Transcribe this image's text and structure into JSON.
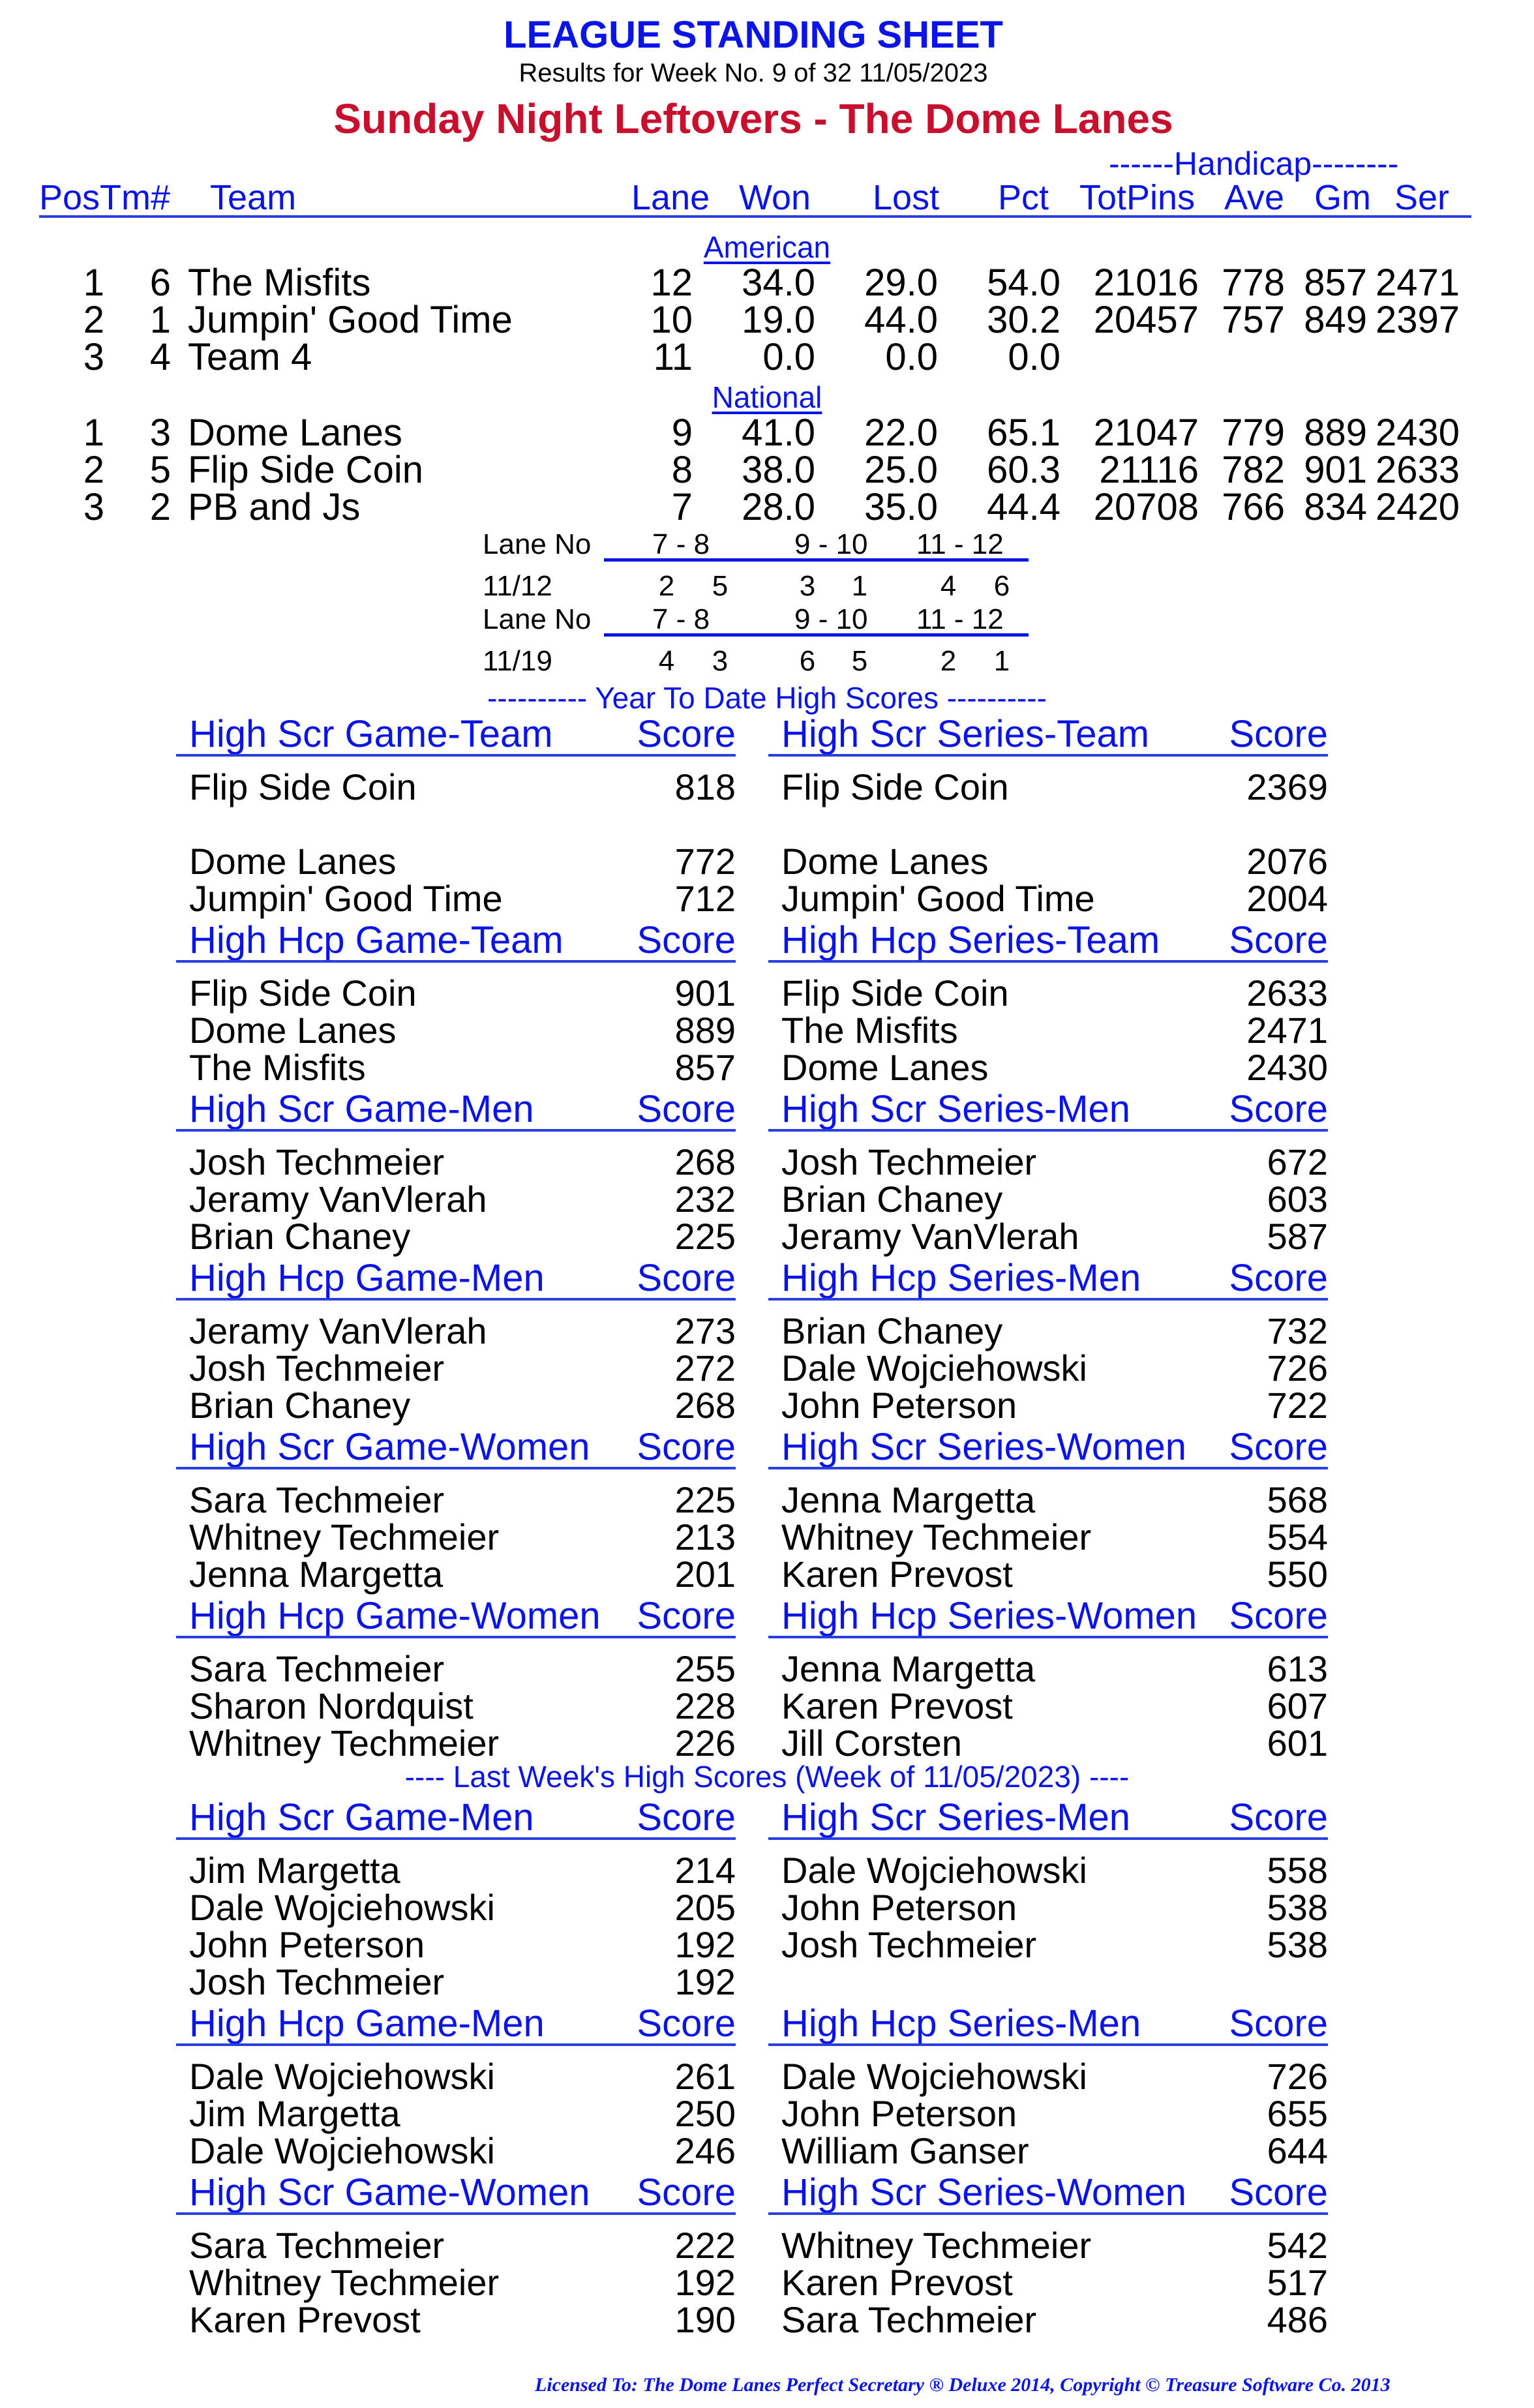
{
  "header": {
    "title": "LEAGUE STANDING SHEET",
    "subtitle": "Results for Week No. 9 of 32    11/05/2023",
    "league_name": "Sunday Night Leftovers - The Dome Lanes",
    "handicap_label": "------Handicap--------"
  },
  "columns": {
    "pos_tm": "PosTm#",
    "team": "Team",
    "lane": "Lane",
    "won": "Won",
    "lost": "Lost",
    "pct": "Pct",
    "totpins": "TotPins",
    "ave": "Ave",
    "gm": "Gm",
    "ser": "Ser"
  },
  "divisions": [
    {
      "name": "American",
      "teams": [
        {
          "pos": "1",
          "tm": "6",
          "team": "The Misfits",
          "lane": "12",
          "won": "34.0",
          "lost": "29.0",
          "pct": "54.0",
          "totpins": "21016",
          "ave": "778",
          "gm": "857",
          "ser": "2471"
        },
        {
          "pos": "2",
          "tm": "1",
          "team": "Jumpin' Good Time",
          "lane": "10",
          "won": "19.0",
          "lost": "44.0",
          "pct": "30.2",
          "totpins": "20457",
          "ave": "757",
          "gm": "849",
          "ser": "2397"
        },
        {
          "pos": "3",
          "tm": "4",
          "team": "Team 4",
          "lane": "11",
          "won": "0.0",
          "lost": "0.0",
          "pct": "0.0",
          "totpins": "",
          "ave": "",
          "gm": "",
          "ser": ""
        }
      ]
    },
    {
      "name": "National",
      "teams": [
        {
          "pos": "1",
          "tm": "3",
          "team": "Dome Lanes",
          "lane": "9",
          "won": "41.0",
          "lost": "22.0",
          "pct": "65.1",
          "totpins": "21047",
          "ave": "779",
          "gm": "889",
          "ser": "2430"
        },
        {
          "pos": "2",
          "tm": "5",
          "team": "Flip Side Coin",
          "lane": "8",
          "won": "38.0",
          "lost": "25.0",
          "pct": "60.3",
          "totpins": "21116",
          "ave": "782",
          "gm": "901",
          "ser": "2633"
        },
        {
          "pos": "3",
          "tm": "2",
          "team": "PB and Js",
          "lane": "7",
          "won": "28.0",
          "lost": "35.0",
          "pct": "44.4",
          "totpins": "20708",
          "ave": "766",
          "gm": "834",
          "ser": "2420"
        }
      ]
    }
  ],
  "lane_schedule": {
    "label": "Lane No",
    "pairs": [
      "7 -  8",
      "9 - 10",
      "11 - 12"
    ],
    "weeks": [
      {
        "date": "11/12",
        "teams": [
          "2",
          "5",
          "3",
          "1",
          "4",
          "6"
        ]
      },
      {
        "date": "11/19",
        "teams": [
          "4",
          "3",
          "6",
          "5",
          "2",
          "1"
        ]
      }
    ]
  },
  "ytd_banner": "---------- Year To Date High Scores ----------",
  "last_week_banner": "----  Last Week's High Scores   (Week of 11/05/2023)  ----",
  "score_label": "Score",
  "ytd_sections": [
    [
      {
        "title": "High Scr Game-Team",
        "rows": [
          [
            "Flip Side Coin",
            "818"
          ],
          [
            "",
            ""
          ],
          [
            "Dome Lanes",
            "772"
          ],
          [
            "Jumpin' Good Time",
            "712"
          ]
        ]
      },
      {
        "title": "High Scr Series-Team",
        "rows": [
          [
            "Flip Side Coin",
            "2369"
          ],
          [
            "",
            ""
          ],
          [
            "Dome Lanes",
            "2076"
          ],
          [
            "Jumpin' Good Time",
            "2004"
          ]
        ]
      }
    ],
    [
      {
        "title": "High Hcp Game-Team",
        "rows": [
          [
            "Flip Side Coin",
            "901"
          ],
          [
            "Dome Lanes",
            "889"
          ],
          [
            "The Misfits",
            "857"
          ]
        ]
      },
      {
        "title": "High Hcp Series-Team",
        "rows": [
          [
            "Flip Side Coin",
            "2633"
          ],
          [
            "The Misfits",
            "2471"
          ],
          [
            "Dome Lanes",
            "2430"
          ]
        ]
      }
    ],
    [
      {
        "title": "High Scr Game-Men",
        "rows": [
          [
            "Josh Techmeier",
            "268"
          ],
          [
            "Jeramy VanVlerah",
            "232"
          ],
          [
            "Brian Chaney",
            "225"
          ]
        ]
      },
      {
        "title": "High Scr Series-Men",
        "rows": [
          [
            "Josh Techmeier",
            "672"
          ],
          [
            "Brian Chaney",
            "603"
          ],
          [
            "Jeramy VanVlerah",
            "587"
          ]
        ]
      }
    ],
    [
      {
        "title": "High Hcp Game-Men",
        "rows": [
          [
            "Jeramy VanVlerah",
            "273"
          ],
          [
            "Josh Techmeier",
            "272"
          ],
          [
            "Brian Chaney",
            "268"
          ]
        ]
      },
      {
        "title": "High Hcp Series-Men",
        "rows": [
          [
            "Brian Chaney",
            "732"
          ],
          [
            "Dale Wojciehowski",
            "726"
          ],
          [
            "John Peterson",
            "722"
          ]
        ]
      }
    ],
    [
      {
        "title": "High Scr Game-Women",
        "rows": [
          [
            "Sara Techmeier",
            "225"
          ],
          [
            "Whitney Techmeier",
            "213"
          ],
          [
            "Jenna Margetta",
            "201"
          ]
        ]
      },
      {
        "title": "High Scr Series-Women",
        "rows": [
          [
            "Jenna Margetta",
            "568"
          ],
          [
            "Whitney Techmeier",
            "554"
          ],
          [
            "Karen Prevost",
            "550"
          ]
        ]
      }
    ],
    [
      {
        "title": "High Hcp Game-Women",
        "rows": [
          [
            "Sara Techmeier",
            "255"
          ],
          [
            "Sharon Nordquist",
            "228"
          ],
          [
            "Whitney Techmeier",
            "226"
          ]
        ]
      },
      {
        "title": "High Hcp Series-Women",
        "rows": [
          [
            "Jenna Margetta",
            "613"
          ],
          [
            "Karen Prevost",
            "607"
          ],
          [
            "Jill Corsten",
            "601"
          ]
        ]
      }
    ]
  ],
  "last_week_sections": [
    [
      {
        "title": "High Scr Game-Men",
        "rows": [
          [
            "Jim Margetta",
            "214"
          ],
          [
            "Dale Wojciehowski",
            "205"
          ],
          [
            "John Peterson",
            "192"
          ],
          [
            "Josh Techmeier",
            "192"
          ]
        ]
      },
      {
        "title": "High Scr Series-Men",
        "rows": [
          [
            "Dale Wojciehowski",
            "558"
          ],
          [
            "John Peterson",
            "538"
          ],
          [
            "Josh Techmeier",
            "538"
          ],
          [
            "",
            ""
          ]
        ]
      }
    ],
    [
      {
        "title": "High Hcp Game-Men",
        "rows": [
          [
            "Dale Wojciehowski",
            "261"
          ],
          [
            "Jim Margetta",
            "250"
          ],
          [
            "Dale Wojciehowski",
            "246"
          ]
        ]
      },
      {
        "title": "High Hcp Series-Men",
        "rows": [
          [
            "Dale Wojciehowski",
            "726"
          ],
          [
            "John Peterson",
            "655"
          ],
          [
            "William Ganser",
            "644"
          ]
        ]
      }
    ],
    [
      {
        "title": "High Scr Game-Women",
        "rows": [
          [
            "Sara Techmeier",
            "222"
          ],
          [
            "Whitney Techmeier",
            "192"
          ],
          [
            "Karen Prevost",
            "190"
          ]
        ]
      },
      {
        "title": "High Scr Series-Women",
        "rows": [
          [
            "Whitney Techmeier",
            "542"
          ],
          [
            "Karen Prevost",
            "517"
          ],
          [
            "Sara Techmeier",
            "486"
          ]
        ]
      }
    ]
  ],
  "footer": "Licensed To: The Dome Lanes     Perfect Secretary ® Deluxe  2014, Copyright © Treasure Software Co. 2013",
  "colors": {
    "heading_blue": "#0a14e6",
    "league_red": "#c8102e",
    "text": "#000000"
  }
}
